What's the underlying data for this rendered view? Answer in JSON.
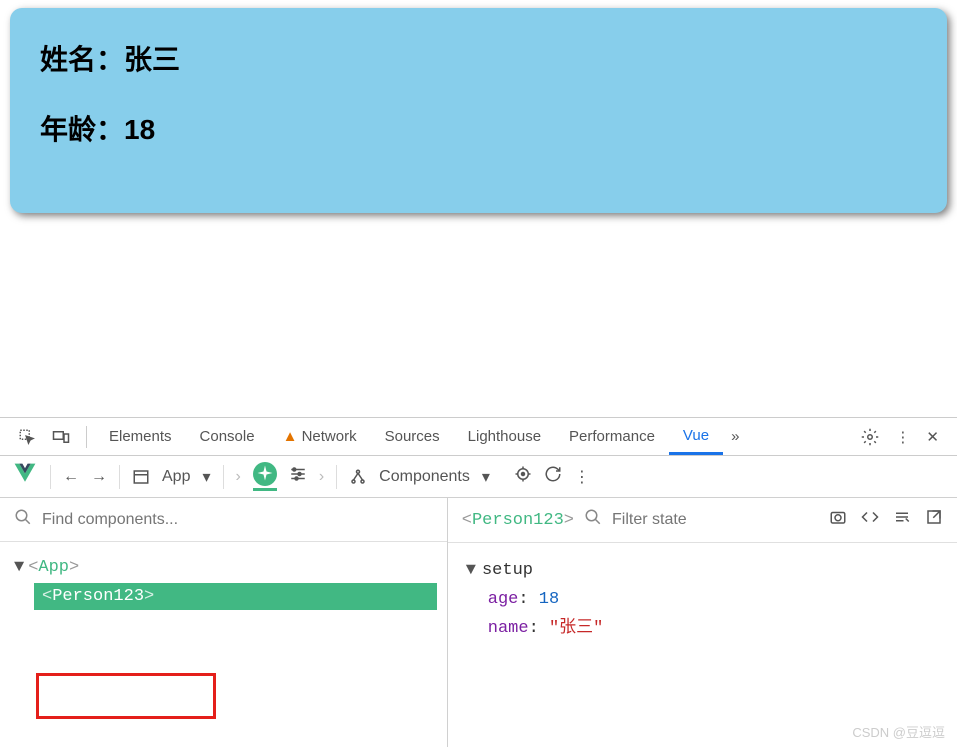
{
  "card": {
    "name_label": "姓名：",
    "name_value": "张三",
    "age_label": "年龄：",
    "age_value": "18"
  },
  "devtools": {
    "tabs": {
      "elements": "Elements",
      "console": "Console",
      "network": "Network",
      "sources": "Sources",
      "lighthouse": "Lighthouse",
      "performance": "Performance",
      "vue": "Vue"
    },
    "toolbar": {
      "app_selector": "App",
      "components_label": "Components"
    },
    "search": {
      "placeholder": "Find components..."
    },
    "tree": {
      "root": "App",
      "child": "Person123"
    },
    "inspector": {
      "selected": "Person123",
      "filter_placeholder": "Filter state",
      "section": "setup",
      "props": {
        "age_key": "age",
        "age_val": "18",
        "name_key": "name",
        "name_val": "\"张三\""
      }
    }
  },
  "watermark": "CSDN @豆逗逗"
}
